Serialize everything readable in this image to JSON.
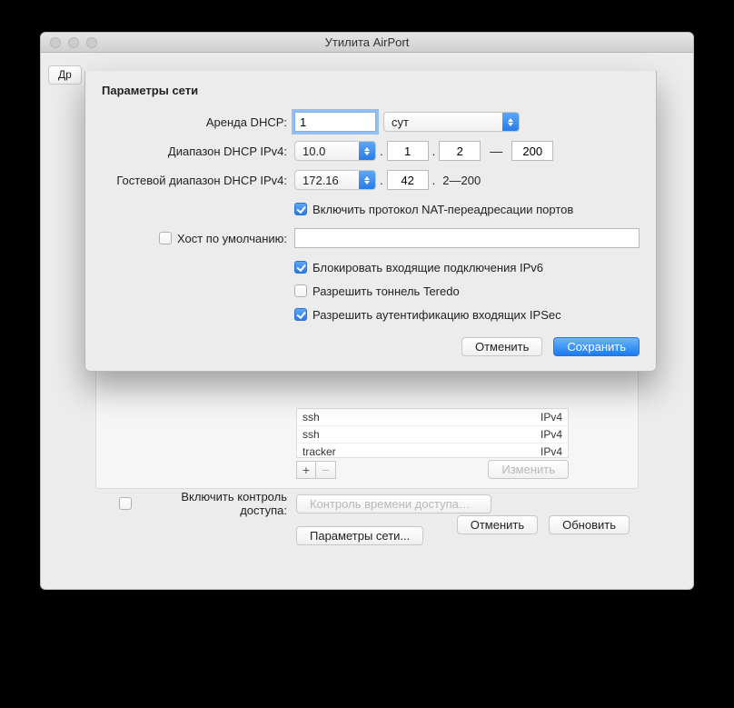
{
  "window": {
    "title": "Утилита AirPort"
  },
  "back_button": "Др",
  "bg_panel": {
    "list_rows": [
      {
        "name": "ssh",
        "proto": "IPv4"
      },
      {
        "name": "ssh",
        "proto": "IPv4"
      },
      {
        "name": "tracker",
        "proto": "IPv4"
      }
    ],
    "edit_btn": "Изменить",
    "access_control_checkbox": "Включить контроль доступа:",
    "access_time_btn": "Контроль времени доступа…",
    "net_params_btn": "Параметры сети...",
    "footer": {
      "cancel": "Отменить",
      "update": "Обновить"
    }
  },
  "sheet": {
    "title": "Параметры сети",
    "dhcp_lease": {
      "label": "Аренда DHCP:",
      "value": "1",
      "unit": "сут"
    },
    "dhcp_range": {
      "label": "Диапазон DHCP IPv4:",
      "subnet": "10.0",
      "sep_dot": ".",
      "oct1": "1",
      "oct2": "2",
      "dash": "—",
      "end": "200"
    },
    "guest_range": {
      "label": "Гостевой диапазон DHCP IPv4:",
      "subnet": "172.16",
      "oct": "42",
      "static_range": "2—200"
    },
    "nat_pmp": {
      "checked": true,
      "label": "Включить протокол NAT-переадресации портов"
    },
    "default_host": {
      "label": "Хост по умолчанию:",
      "checked": false,
      "value": ""
    },
    "block_ipv6": {
      "checked": true,
      "label": "Блокировать входящие подключения IPv6"
    },
    "teredo": {
      "checked": false,
      "label": "Разрешить тоннель Teredo"
    },
    "ipsec": {
      "checked": true,
      "label": "Разрешить аутентификацию входящих IPSec"
    },
    "footer": {
      "cancel": "Отменить",
      "save": "Сохранить"
    }
  }
}
